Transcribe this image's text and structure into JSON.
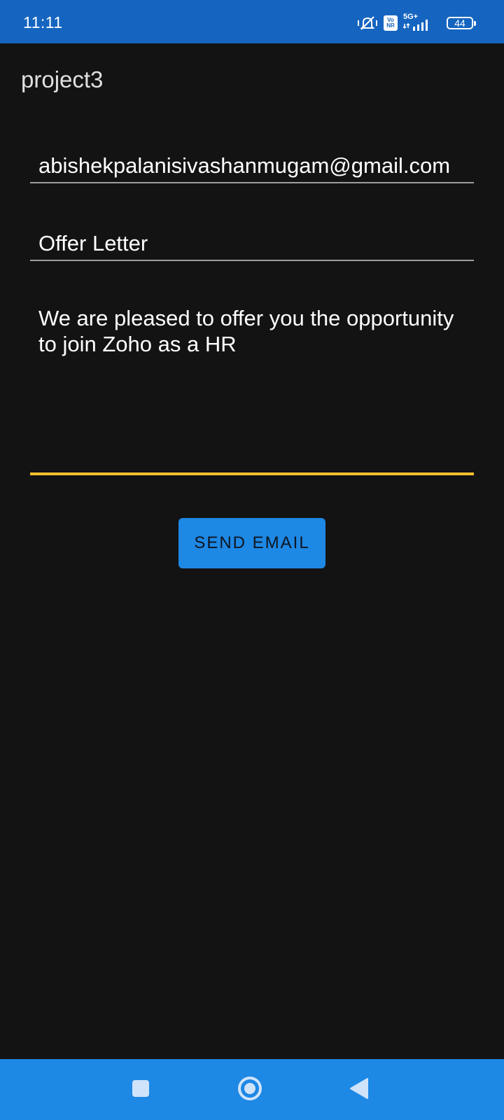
{
  "status_bar": {
    "time": "11:11",
    "network": "5G+",
    "volte": "Vo NR",
    "battery": "44"
  },
  "app": {
    "title": "project3"
  },
  "form": {
    "to_value": "abishekpalanisivashanmugam@gmail.com",
    "subject_value": "Offer Letter",
    "body_value": "We are pleased to offer you the opportunity to join Zoho as a HR",
    "send_label": "SEND EMAIL"
  },
  "nav": {
    "recents_icon": "square-icon",
    "home_icon": "circle-icon",
    "back_icon": "triangle-back-icon"
  },
  "colors": {
    "status_bar": "#1565c0",
    "background": "#131313",
    "accent": "#1e88e5",
    "focus_underline": "#fbc02d"
  }
}
